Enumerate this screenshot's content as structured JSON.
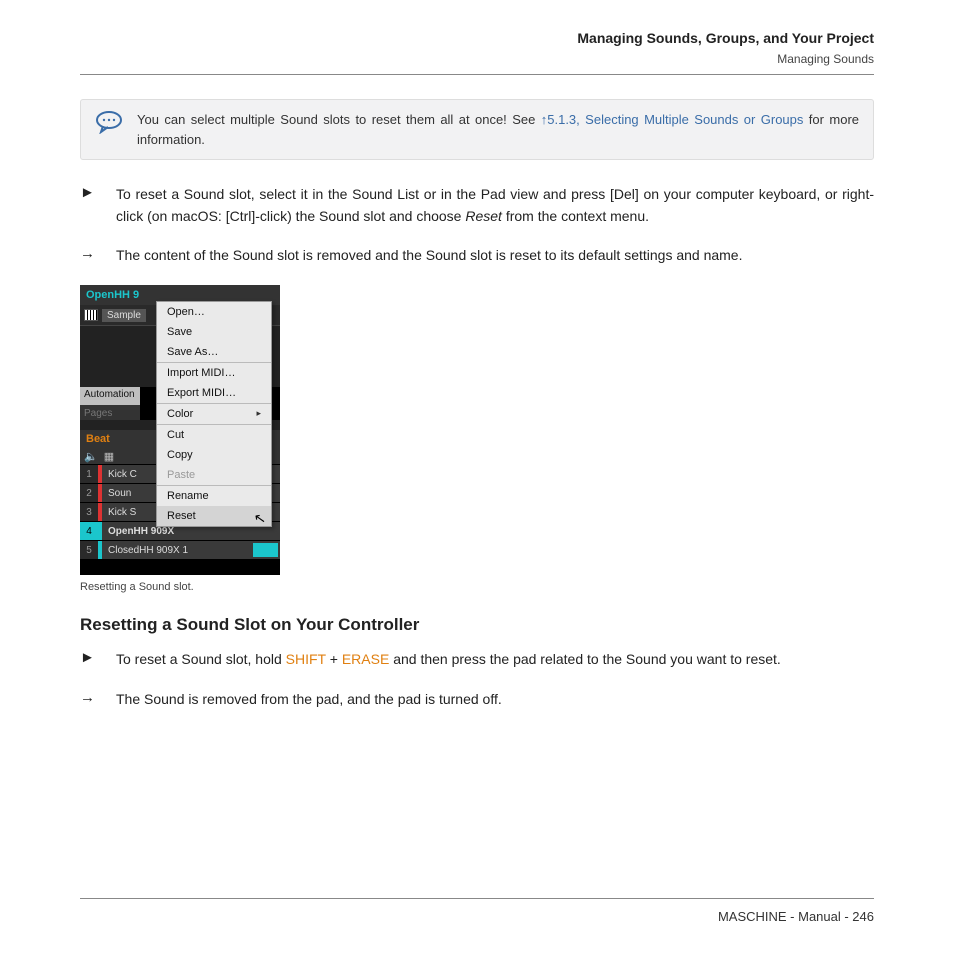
{
  "header": {
    "title": "Managing Sounds, Groups, and Your Project",
    "subtitle": "Managing Sounds"
  },
  "tip": {
    "text_before": "You can select multiple Sound slots to reset them all at once! See ",
    "link": "↑5.1.3, Selecting Multiple Sounds or Groups",
    "text_after": " for more information."
  },
  "steps": {
    "s1": {
      "marker": "►",
      "part1": "To reset a Sound slot, select it in the Sound List or in the Pad view and press [Del] on your computer keyboard, or right-click (on macOS: [Ctrl]-click) the Sound slot and choose ",
      "italic": "Reset",
      "part2": " from the context menu."
    },
    "s2": {
      "marker": "→",
      "text": "The content of the Sound slot is removed and the Sound slot is reset to its default settings and name."
    }
  },
  "figure": {
    "caption": "Resetting a Sound slot.",
    "header_sound": "OpenHH 9",
    "sample_tab": "Sample",
    "automation": "Automation",
    "pages": "Pages",
    "beat": "Beat",
    "rows": [
      {
        "num": "1",
        "label": "Kick C"
      },
      {
        "num": "2",
        "label": "Soun"
      },
      {
        "num": "3",
        "label": "Kick S"
      },
      {
        "num": "4",
        "label": "OpenHH 909X"
      },
      {
        "num": "5",
        "label": "ClosedHH 909X 1"
      }
    ],
    "menu": [
      "Open…",
      "Save",
      "Save As…",
      "Import MIDI…",
      "Export MIDI…",
      "Color",
      "Cut",
      "Copy",
      "Paste",
      "Rename",
      "Reset"
    ]
  },
  "subheading": "Resetting a Sound Slot on Your Controller",
  "controller_step": {
    "marker": "►",
    "p1": "To reset a Sound slot, hold ",
    "k1": "SHIFT",
    "plus": " + ",
    "k2": "ERASE",
    "p2": " and then press the pad related to the Sound you want to reset."
  },
  "result_step": {
    "marker": "→",
    "text": "The Sound is removed from the pad, and the pad is turned off."
  },
  "footer": "MASCHINE - Manual - 246"
}
